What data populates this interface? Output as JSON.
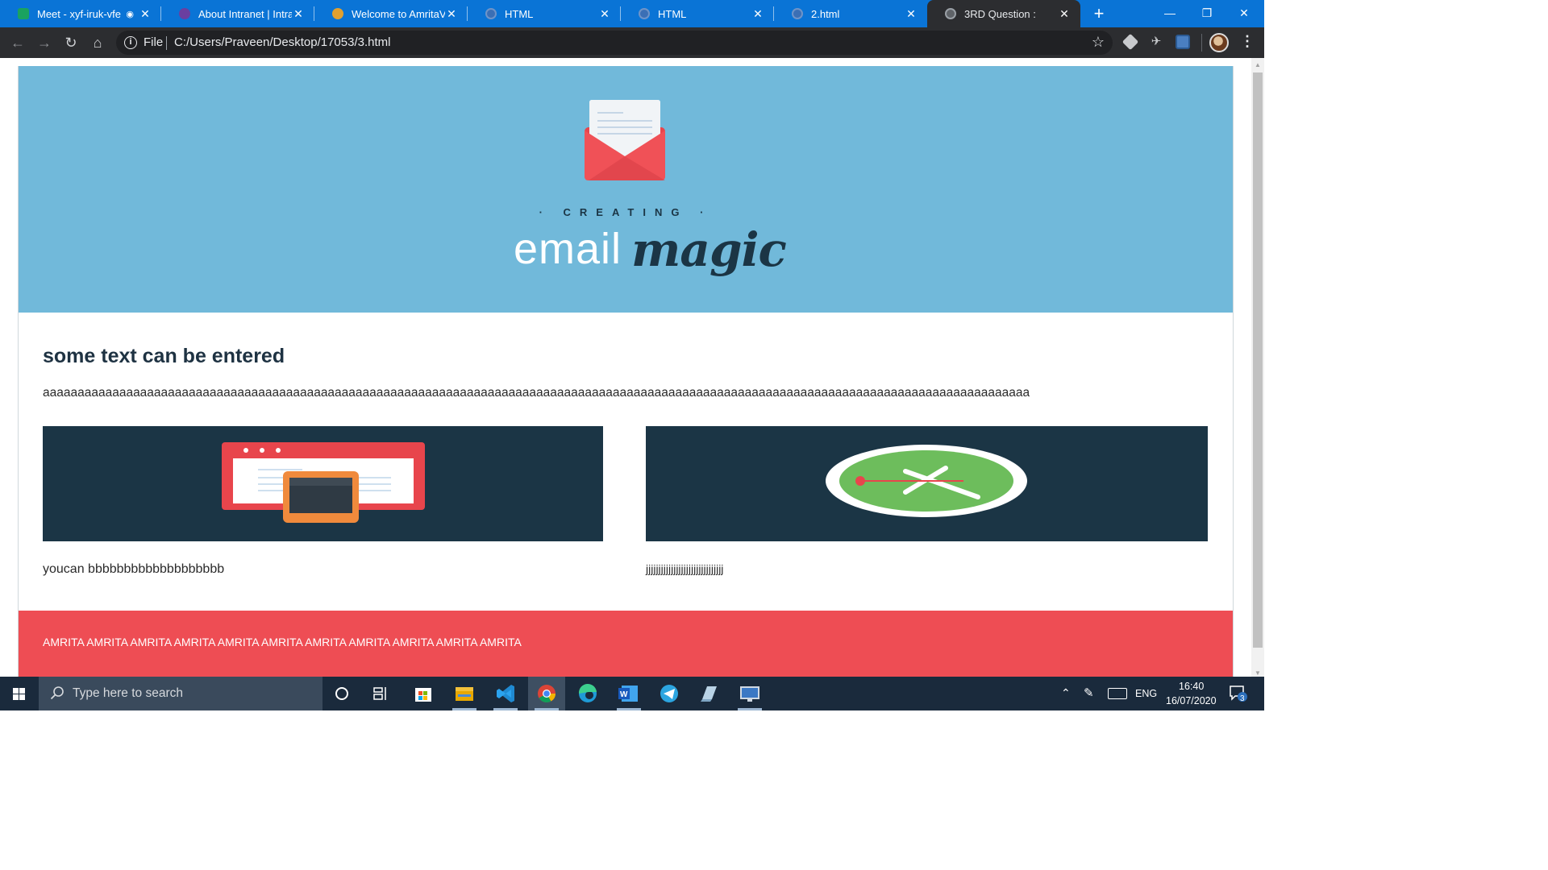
{
  "browser": {
    "tabs": [
      {
        "title": "Meet - xyf-iruk-vfe",
        "favicon_color": "#1aa260",
        "active": false
      },
      {
        "title": "About Intranet | Intranet",
        "favicon_color": "#6a3fa0",
        "active": false
      },
      {
        "title": "Welcome to AmritaVidya",
        "favicon_color": "#e0a030",
        "active": false
      },
      {
        "title": "HTML",
        "favicon_color": "#7f8fa6",
        "active": false
      },
      {
        "title": "HTML",
        "favicon_color": "#7f8fa6",
        "active": false
      },
      {
        "title": "2.html",
        "favicon_color": "#7f8fa6",
        "active": false
      },
      {
        "title": "3RD Question :",
        "favicon_color": "#9aa0a6",
        "active": true
      }
    ],
    "new_tab_label": "+",
    "window_controls": {
      "minimize": "—",
      "restore": "❐",
      "close": "✕"
    },
    "address": {
      "scheme_label": "File",
      "url": "C:/Users/Praveen/Desktop/17053/3.html"
    }
  },
  "page": {
    "hero": {
      "logo_small": "· CREATING ·",
      "logo_word1": "email",
      "logo_word2": "magic",
      "background": "#71b9da"
    },
    "heading": "some text can be entered",
    "paragraph": "aaaaaaaaaaaaaaaaaaaaaaaaaaaaaaaaaaaaaaaaaaaaaaaaaaaaaaaaaaaaaaaaaaaaaaaaaaaaaaaaaaaaaaaaaaaaaaaaaaaaaaaaaaaaaaaaaaaaaaaaaaaaaaaaaaaaaaaaaaaaaa",
    "cards": [
      {
        "caption": "youcan bbbbbbbbbbbbbbbbbbb",
        "image": "browser-tablet-illustration"
      },
      {
        "caption": "jjjjjjjjjjjjjjjjjjjjjjjjjjjjjjj",
        "image": "clock-illustration"
      }
    ],
    "footer": {
      "text": "AMRITA AMRITA AMRITA AMRITA AMRITA AMRITA AMRITA AMRITA AMRITA AMRITA AMRITA",
      "background": "#ee4d54"
    }
  },
  "taskbar": {
    "search_placeholder": "Type here to search",
    "apps": [
      "cortana-icon",
      "task-view-icon",
      "store-icon",
      "file-explorer-icon",
      "vscode-icon",
      "chrome-icon",
      "edge-icon",
      "word-icon",
      "telegram-icon",
      "notes-icon",
      "remote-desktop-icon"
    ],
    "language": "ENG",
    "time": "16:40",
    "date": "16/07/2020",
    "notifications_count": "3"
  }
}
